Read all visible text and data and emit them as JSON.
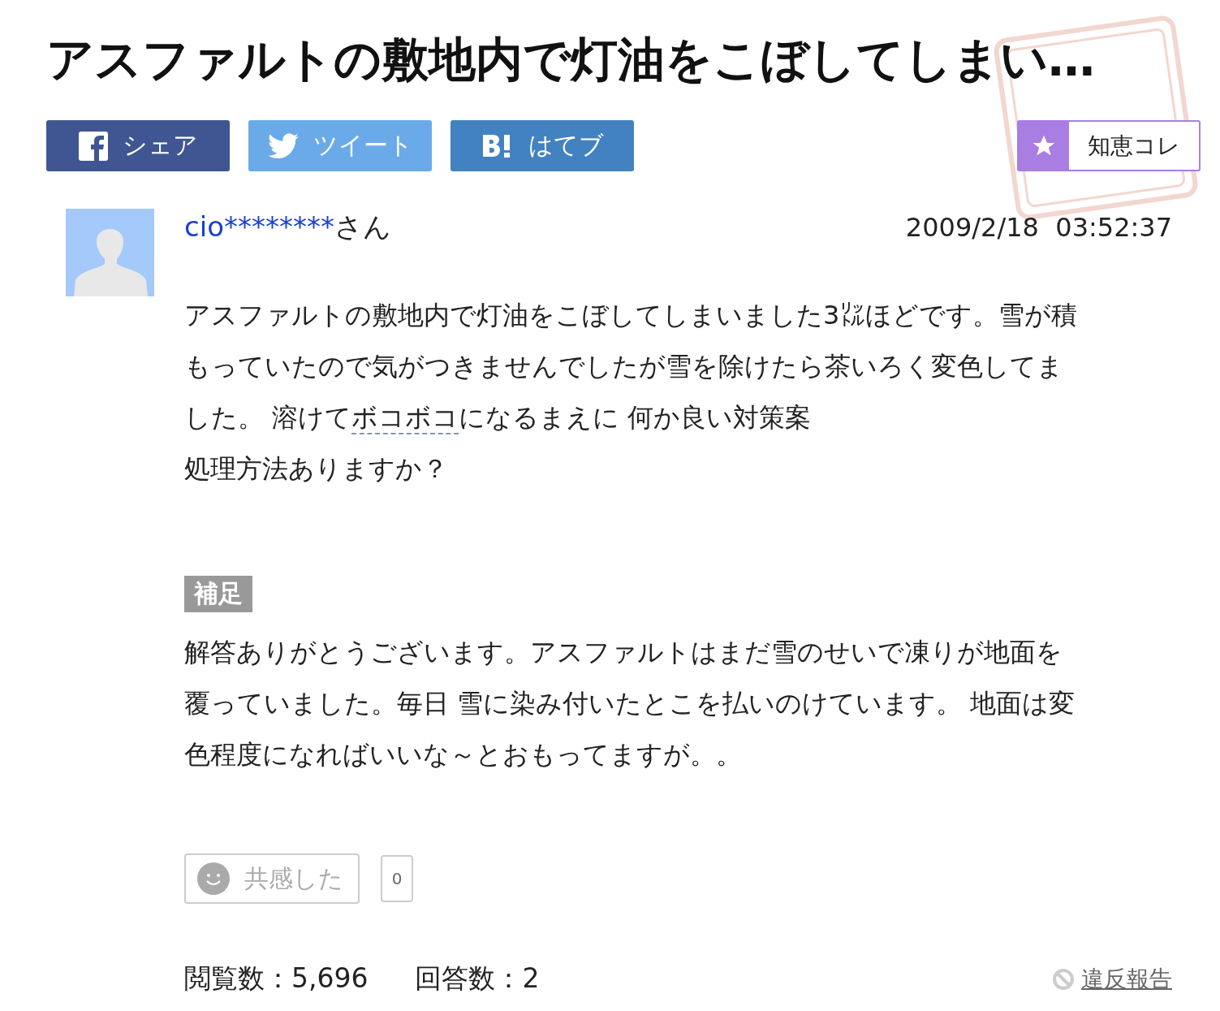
{
  "title": "アスファルトの敷地内で灯油をこぼしてしまい…",
  "share_buttons": [
    {
      "kind": "facebook",
      "label": "シェア"
    },
    {
      "kind": "twitter",
      "label": "ツイート"
    },
    {
      "kind": "hatena",
      "label": "はてブ"
    }
  ],
  "collect_button": {
    "label": "知恵コレ"
  },
  "question": {
    "user": "cio********",
    "user_suffix": "さん",
    "date": "2009/2/18  03:52:37",
    "body": [
      [
        {
          "kind": "text",
          "text": "アスファルトの敷地内で灯油をこぼしてしまいました3㍑ほどです。雪が積"
        }
      ],
      [
        {
          "kind": "text",
          "text": "もっていたので気がつきませんでしたが雪を除けたら茶いろく変色してま"
        }
      ],
      [
        {
          "kind": "text",
          "text": "した。 溶けて"
        },
        {
          "kind": "keyword",
          "text": "ボコボコ"
        },
        {
          "kind": "text",
          "text": "になるまえに 何か良い対策案"
        }
      ],
      [
        {
          "kind": "text",
          "text": "処理方法ありますか？"
        }
      ]
    ],
    "supplement_label": "補足",
    "supplement": [
      "解答ありがとうございます。アスファルトはまだ雪のせいで凍りが地面を",
      "覆っていました。毎日 雪に染み付いたとこを払いのけています。 地面は変",
      "色程度になればいいな～とおもってますが。。"
    ],
    "empathy_button": "共感した",
    "empathy_count": "0",
    "views": "閲覧数：5,696",
    "answers": "回答数：2",
    "report": "違反報告"
  }
}
